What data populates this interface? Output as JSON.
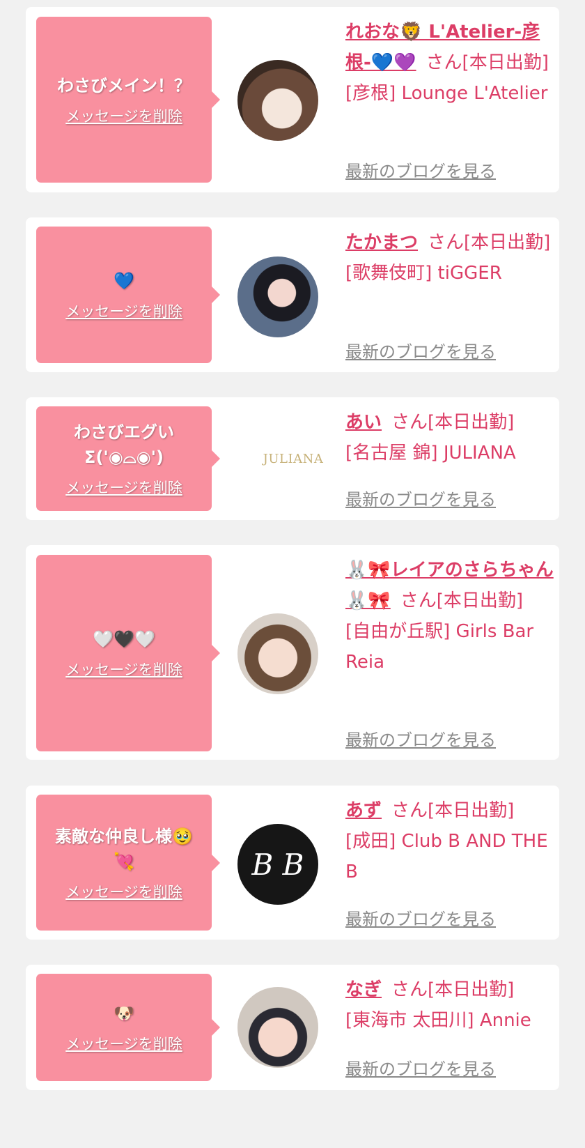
{
  "delete_label": "メッセージを削除",
  "blog_label": "最新のブログを見る",
  "entries": [
    {
      "message": "わさびメイン！？",
      "name": "れおな🦁 L'Atelier-彦根-💙💜",
      "suffix": "さん[本日出勤]",
      "shop": "[彦根] Lounge L'Atelier",
      "avatar": "cast-photo"
    },
    {
      "message": "💙",
      "name": "たかまつ",
      "suffix": "さん[本日出勤]",
      "shop": "[歌舞伎町] tiGGER",
      "avatar": "cast-photo"
    },
    {
      "message": "わさびエグい Σ('◉⌓◉')",
      "name": "あい",
      "suffix": "さん[本日出勤]",
      "shop": "[名古屋 錦] JULIANA",
      "logo_text": "JULIANA"
    },
    {
      "message": "🤍🖤🤍",
      "name": "🐰🎀レイアのさらちゃん🐰🎀",
      "suffix": "さん[本日出勤]",
      "shop": "[自由が丘駅] Girls Bar Reia",
      "avatar": "cast-photo"
    },
    {
      "message": "素敵な仲良し様🥹 💘",
      "name": "あず",
      "suffix": "さん[本日出勤]",
      "shop": "[成田] Club B AND THE B",
      "logo_text": "B B"
    },
    {
      "message": "🐶",
      "name": "なぎ",
      "suffix": "さん[本日出勤]",
      "shop": "[東海市 太田川] Annie",
      "avatar": "cast-photo"
    }
  ]
}
